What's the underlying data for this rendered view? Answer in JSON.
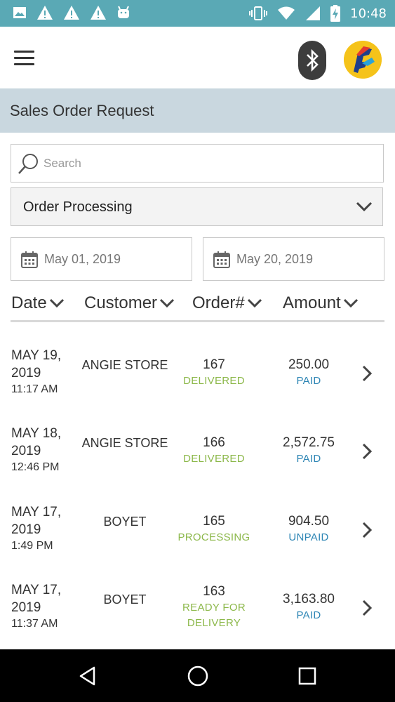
{
  "status_bar": {
    "time": "10:48",
    "icons_left": [
      "image-icon",
      "warning-icon",
      "warning-icon",
      "warning-icon",
      "android-icon"
    ],
    "icons_right": [
      "vibrate-icon",
      "wifi-icon",
      "signal-icon",
      "battery-charging-icon"
    ]
  },
  "app_bar": {
    "menu_icon": "hamburger-menu-icon",
    "bluetooth_icon": "bluetooth-icon",
    "avatar_icon": "company-logo-icon"
  },
  "page": {
    "title": "Sales Order Request"
  },
  "search": {
    "placeholder": "Search",
    "value": ""
  },
  "status_filter": {
    "selected": "Order Processing"
  },
  "date_range": {
    "from": "May 01, 2019",
    "to": "May 20, 2019"
  },
  "columns": [
    {
      "label": "Date"
    },
    {
      "label": "Customer"
    },
    {
      "label": "Order#"
    },
    {
      "label": "Amount"
    }
  ],
  "orders": [
    {
      "date_line1": "MAY 19,",
      "date_line2": "2019",
      "time": "11:17 AM",
      "customer": "ANGIE STORE",
      "order_no": "167",
      "status_line1": "DELIVERED",
      "status_line2": "",
      "amount": "250.00",
      "payment": "PAID"
    },
    {
      "date_line1": "MAY 18,",
      "date_line2": "2019",
      "time": "12:46 PM",
      "customer": "ANGIE STORE",
      "order_no": "166",
      "status_line1": "DELIVERED",
      "status_line2": "",
      "amount": "2,572.75",
      "payment": "PAID"
    },
    {
      "date_line1": "MAY 17,",
      "date_line2": "2019",
      "time": "1:49 PM",
      "customer": "BOYET",
      "order_no": "165",
      "status_line1": "PROCESSING",
      "status_line2": "",
      "amount": "904.50",
      "payment": "UNPAID"
    },
    {
      "date_line1": "MAY 17,",
      "date_line2": "2019",
      "time": "11:37 AM",
      "customer": "BOYET",
      "order_no": "163",
      "status_line1": "READY FOR",
      "status_line2": "DELIVERY",
      "amount": "3,163.80",
      "payment": "PAID"
    }
  ],
  "colors": {
    "status_bar": "#5aa9b5",
    "title_bar": "#c9d7df",
    "order_status": "#8cb84a",
    "payment_status": "#2e86b5"
  },
  "nav_bar": {
    "icons": [
      "back-icon",
      "home-icon",
      "recents-icon"
    ]
  }
}
